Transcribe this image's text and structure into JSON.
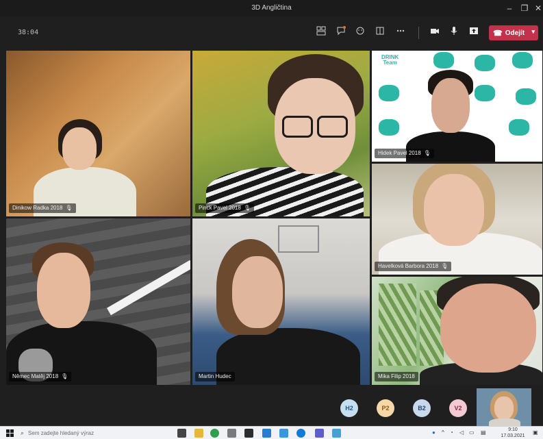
{
  "window": {
    "title": "3D Angličtina"
  },
  "window_controls": {
    "minimize": "–",
    "maximize": "❐",
    "close": "✕"
  },
  "toolbar": {
    "timer": "38:04",
    "leave_label": "Odejít",
    "icons": [
      "participants-icon",
      "chat-icon",
      "reactions-icon",
      "rooms-icon",
      "more-icon",
      "camera-icon",
      "mic-icon",
      "share-icon"
    ]
  },
  "participants": [
    {
      "name": "Dinikow Radka 2018",
      "mic": "muted"
    },
    {
      "name": "Pinck Pavel 2018",
      "mic": "muted"
    },
    {
      "name": "Hidek Pavel 2018",
      "mic": "muted"
    },
    {
      "name": "Havelková Barbora 2018",
      "mic": "muted"
    },
    {
      "name": "Němec Matěj 2018",
      "mic": "muted"
    },
    {
      "name": "Martin Hudec",
      "mic": "on"
    },
    {
      "name": "Mika Filip 2018",
      "mic": "on"
    }
  ],
  "backdrop_logo": {
    "line1": "DRINK",
    "line2": "Team"
  },
  "overflow_avatars": [
    {
      "initials": "H2",
      "bg": "#c5dff1",
      "fg": "#1f5c8a"
    },
    {
      "initials": "P2",
      "bg": "#f6d7a8",
      "fg": "#8a5a14"
    },
    {
      "initials": "B2",
      "bg": "#c9d8ea",
      "fg": "#24466f"
    },
    {
      "initials": "V2",
      "bg": "#f3c9d2",
      "fg": "#8a2a44"
    }
  ],
  "taskbar": {
    "search_placeholder": "Sem zadejte hledaný výraz",
    "clock_time": "9:10",
    "clock_date": "17.03.2021"
  },
  "colors": {
    "leave_button": "#c4314b",
    "app_background": "#1f1f1f"
  }
}
